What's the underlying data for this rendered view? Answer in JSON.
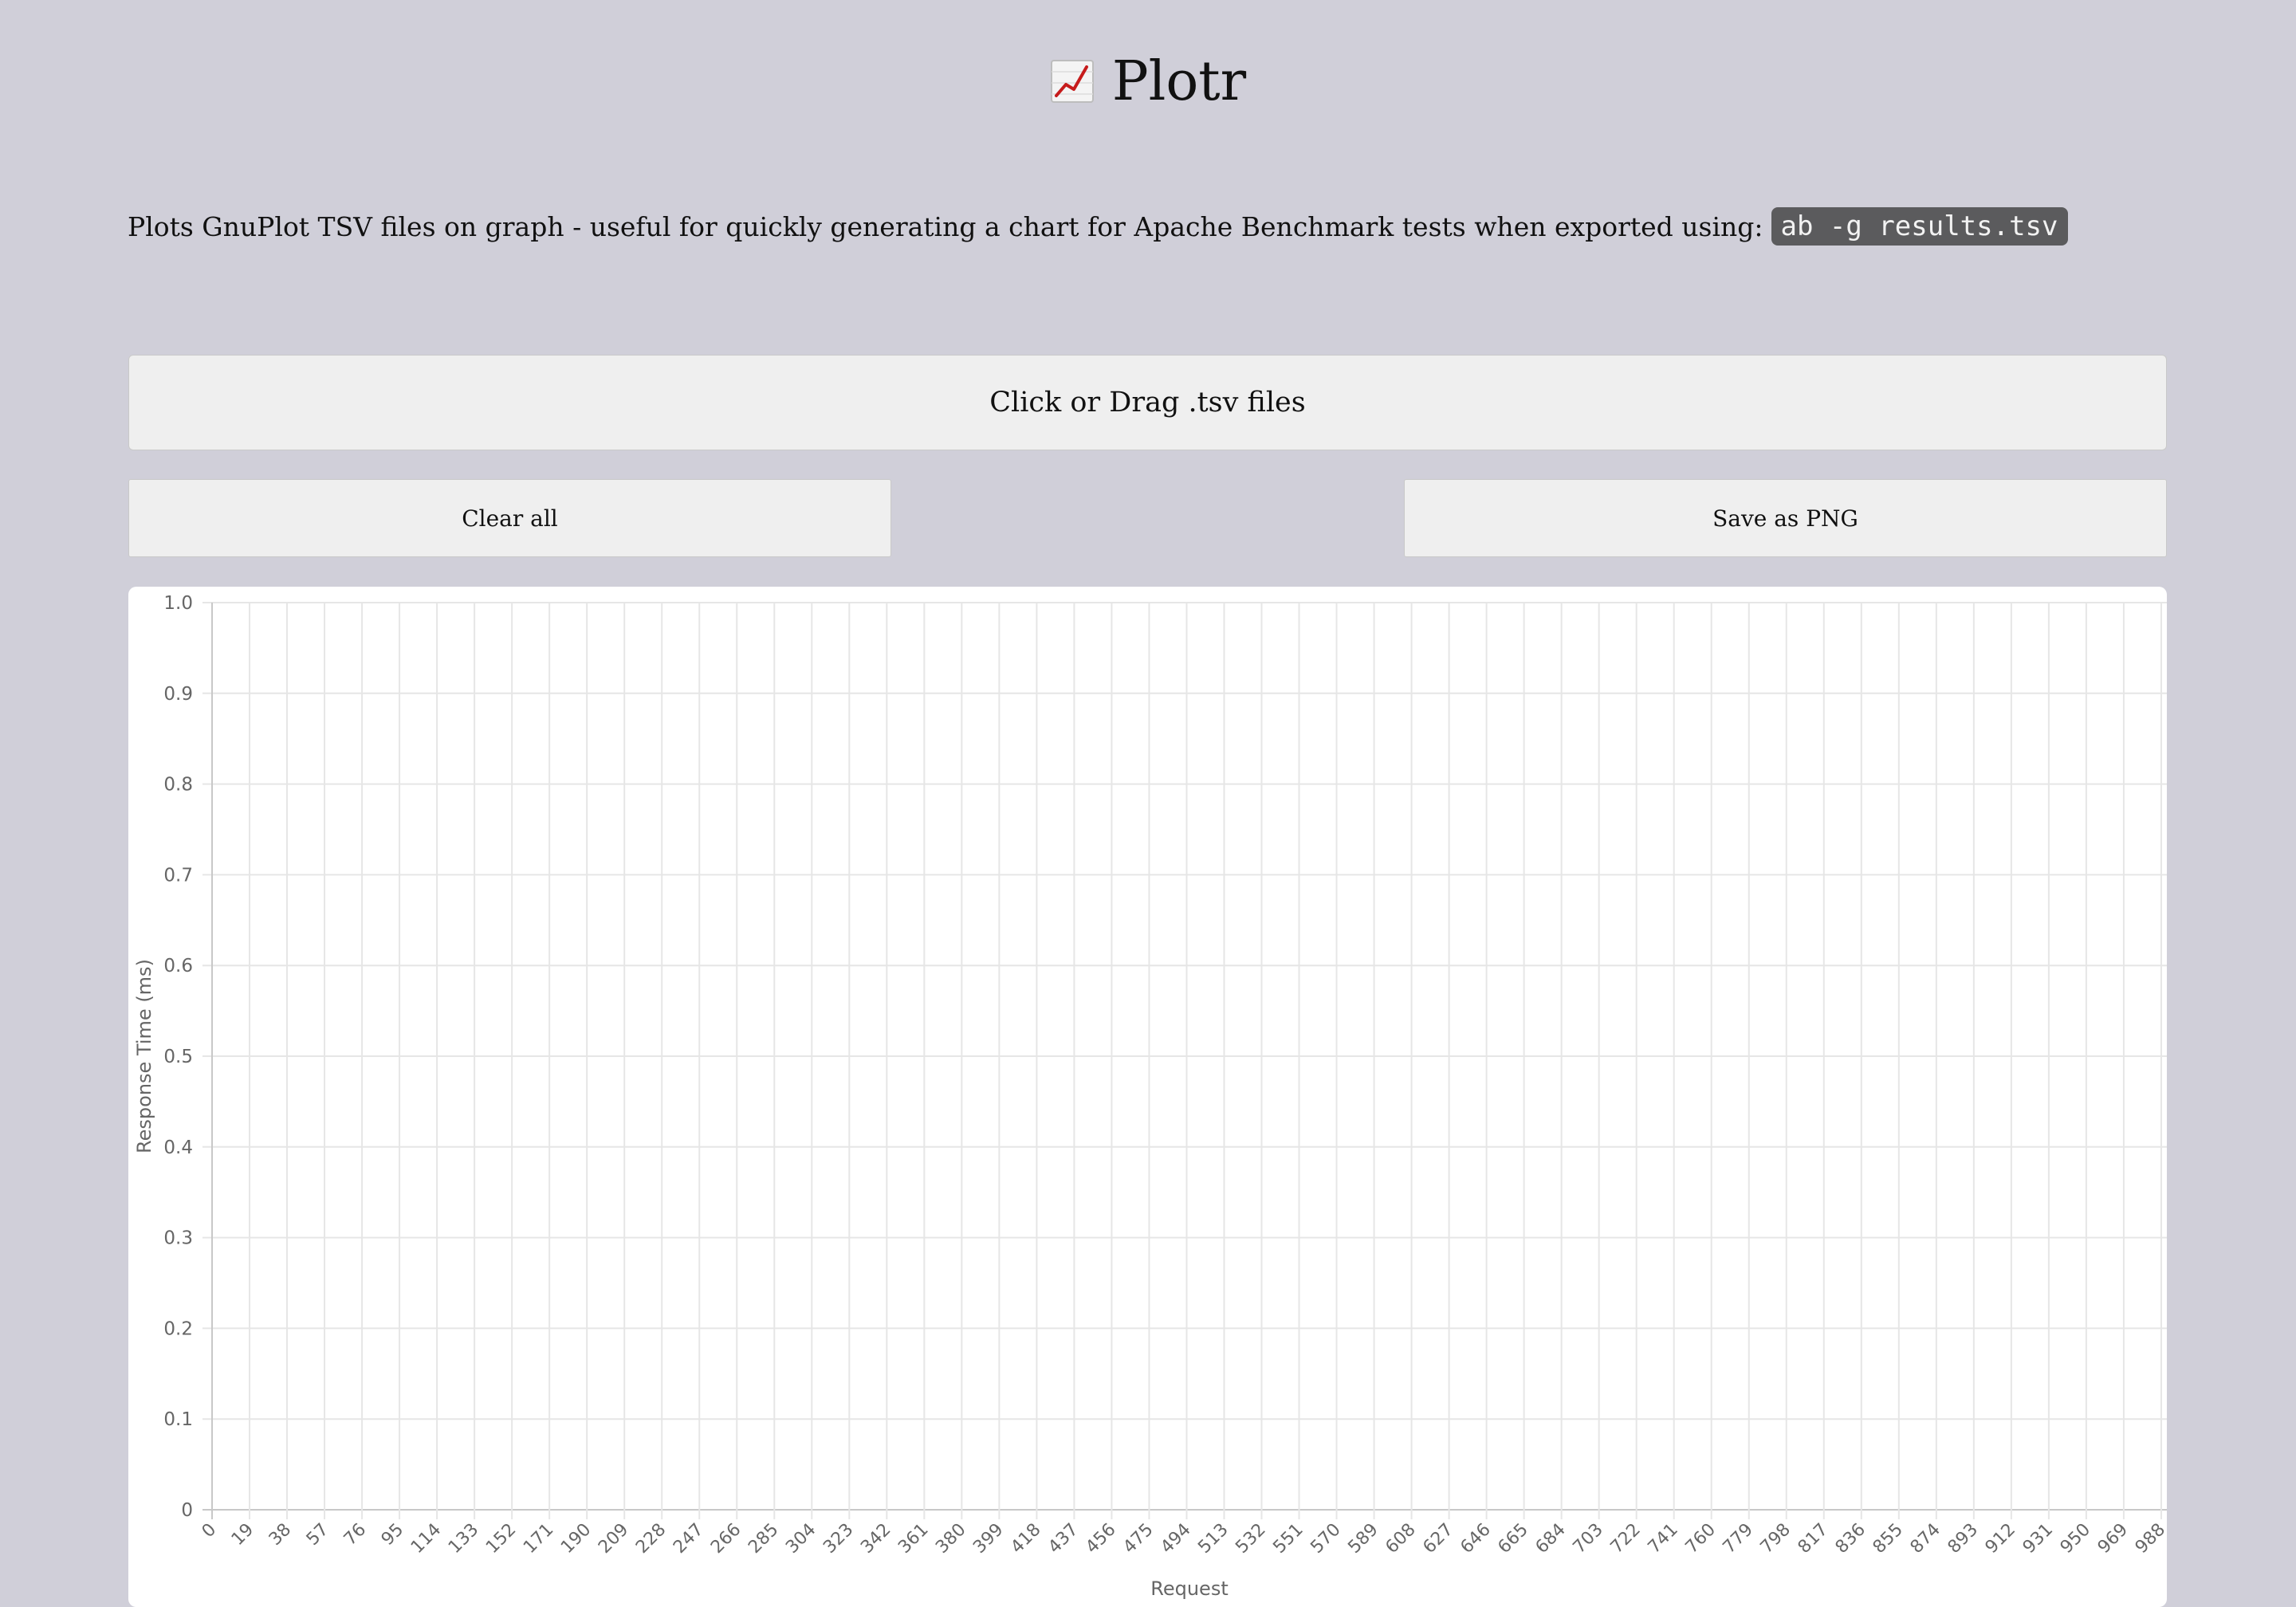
{
  "header": {
    "icon": "chart-increasing-icon",
    "title": "Plotr"
  },
  "intro": {
    "text": "Plots GnuPlot TSV files on graph - useful for quickly generating a chart for Apache Benchmark tests when exported using:",
    "code": "ab -g results.tsv"
  },
  "dropzone": {
    "label": "Click or Drag .tsv files"
  },
  "buttons": {
    "clear_label": "Clear all",
    "save_label": "Save as PNG"
  },
  "chart_data": {
    "type": "line",
    "title": "",
    "xlabel": "Request",
    "ylabel": "Response Time (ms)",
    "x_ticks": [
      0,
      19,
      38,
      57,
      76,
      95,
      114,
      133,
      152,
      171,
      190,
      209,
      228,
      247,
      266,
      285,
      304,
      323,
      342,
      361,
      380,
      399,
      418,
      437,
      456,
      475,
      494,
      513,
      532,
      551,
      570,
      589,
      608,
      627,
      646,
      665,
      684,
      703,
      722,
      741,
      760,
      779,
      798,
      817,
      836,
      855,
      874,
      893,
      912,
      931,
      950,
      969,
      988
    ],
    "y_ticks": [
      "0",
      "0.1",
      "0.2",
      "0.3",
      "0.4",
      "0.5",
      "0.6",
      "0.7",
      "0.8",
      "0.9",
      "1.0"
    ],
    "ylim": [
      0,
      1
    ],
    "grid": true,
    "series": []
  }
}
